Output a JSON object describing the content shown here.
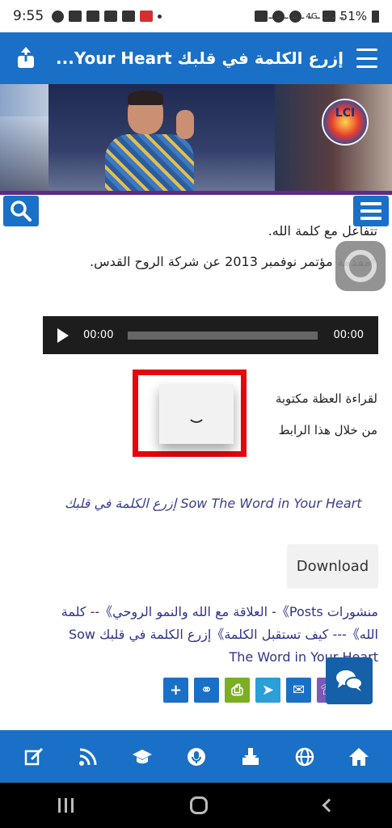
{
  "status_bar": {
    "time": "9:55",
    "battery": "51%",
    "network": "4G"
  },
  "header": {
    "title": "إزرع الكلمة في قلبك Your Heart...",
    "share_icon": "share-icon",
    "menu_icon": "hamburger-icon"
  },
  "banner": {
    "logo_text": "LCI"
  },
  "content": {
    "partial_line": "ـ ـ ـ ـ ـ ـ ـ ـ ـ ـ",
    "line1": "تتفاعل مع كلمة الله.",
    "line2": "*مقدمة مؤتمر نوفمبر 2013  عن شركة الروح القدس.",
    "audio": {
      "current_time": "00:00",
      "duration": "00:00"
    },
    "read_label_1": "لقراءة العظة مكتوبة",
    "read_label_2": "من خلال هذا الرابط",
    "series_link": "إزرع الكلمة في قلبك Sow The Word in Your Heart",
    "download_label": "Download",
    "posts_link": "منشورات Posts》- العلاقة مع الله والنمو الروحي》-- كلمة الله》--- كيف تستقبل الكلمة》إزرع الكلمة في قلبك Sow The Word in Your Heart"
  },
  "share_icons": [
    {
      "name": "whatsapp-share-icon",
      "color": "#25a23b",
      "glyph": "✆"
    },
    {
      "name": "viber-share-icon",
      "color": "#7b5bb5",
      "glyph": "☏"
    },
    {
      "name": "email-share-icon",
      "color": "#1a70c6",
      "glyph": "✉"
    },
    {
      "name": "telegram-share-icon",
      "color": "#2a9fd8",
      "glyph": "➤"
    },
    {
      "name": "print-share-icon",
      "color": "#7cae22",
      "glyph": "⎙"
    },
    {
      "name": "link-share-icon",
      "color": "#1a70c6",
      "glyph": "⚭"
    },
    {
      "name": "add-share-icon",
      "color": "#1a70c6",
      "glyph": "+"
    }
  ],
  "bottom_nav": [
    {
      "name": "edit-nav-icon"
    },
    {
      "name": "rss-nav-icon"
    },
    {
      "name": "graduation-nav-icon"
    },
    {
      "name": "microphone-nav-icon"
    },
    {
      "name": "download-nav-icon"
    },
    {
      "name": "globe-nav-icon"
    },
    {
      "name": "home-nav-icon"
    }
  ],
  "colors": {
    "primary": "#1a70c6",
    "highlight_frame": "#e8060a",
    "link": "#2f338a"
  }
}
